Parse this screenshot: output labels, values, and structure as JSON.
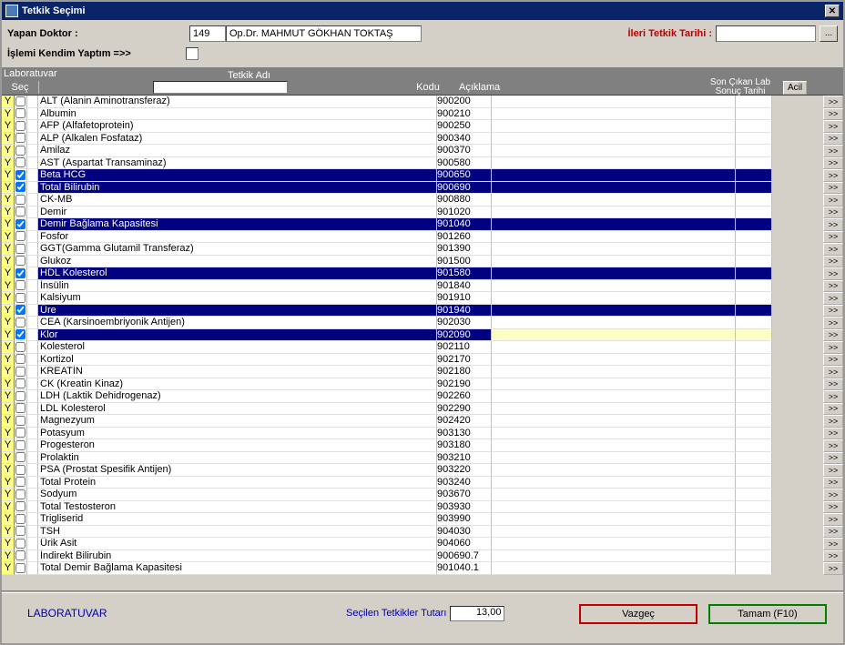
{
  "window": {
    "title": "Tetkik Seçimi"
  },
  "header": {
    "doctor_label": "Yapan Doktor :",
    "doctor_id": "149",
    "doctor_name": "Op.Dr. MAHMUT GÖKHAN TOKTAŞ",
    "ileri_tarih_label": "İleri Tetkik Tarihi :",
    "ileri_tarih_value": "",
    "self_label": "İşlemi Kendim Yaptım =>>"
  },
  "grid": {
    "top_label": "Laboratuvar",
    "col_sec": "Seç",
    "col_name": "Tetkik Adı",
    "col_kodu": "Kodu",
    "col_aciklama": "Açıklama",
    "col_sontarih": "Son Çıkan Lab Sonuç Tarihi",
    "col_acil": "Acil",
    "detail_btn": ">>",
    "search_value": ""
  },
  "rows": [
    {
      "y": "Y",
      "sel": false,
      "name": "ALT (Alanin Aminotransferaz)",
      "kodu": "900200",
      "active": false
    },
    {
      "y": "Y",
      "sel": false,
      "name": "Albumin",
      "kodu": "900210",
      "active": false
    },
    {
      "y": "Y",
      "sel": false,
      "name": "AFP (Alfafetoprotein)",
      "kodu": "900250",
      "active": false
    },
    {
      "y": "Y",
      "sel": false,
      "name": "ALP (Alkalen Fosfataz)",
      "kodu": "900340",
      "active": false
    },
    {
      "y": "Y",
      "sel": false,
      "name": "Amilaz",
      "kodu": "900370",
      "active": false
    },
    {
      "y": "Y",
      "sel": false,
      "name": "AST (Aspartat Transaminaz)",
      "kodu": "900580",
      "active": false
    },
    {
      "y": "Y",
      "sel": true,
      "name": "Beta HCG",
      "kodu": "900650",
      "active": false
    },
    {
      "y": "Y",
      "sel": true,
      "name": "Total Bilirubin",
      "kodu": "900690",
      "active": false
    },
    {
      "y": "Y",
      "sel": false,
      "name": "CK-MB",
      "kodu": "900880",
      "active": false
    },
    {
      "y": "Y",
      "sel": false,
      "name": "Demir",
      "kodu": "901020",
      "active": false
    },
    {
      "y": "Y",
      "sel": true,
      "name": "Demir Bağlama Kapasitesi",
      "kodu": "901040",
      "active": false
    },
    {
      "y": "Y",
      "sel": false,
      "name": "Fosfor",
      "kodu": "901260",
      "active": false
    },
    {
      "y": "Y",
      "sel": false,
      "name": "GGT(Gamma Glutamil Transferaz)",
      "kodu": "901390",
      "active": false
    },
    {
      "y": "Y",
      "sel": false,
      "name": "Glukoz",
      "kodu": "901500",
      "active": false
    },
    {
      "y": "Y",
      "sel": true,
      "name": "HDL Kolesterol",
      "kodu": "901580",
      "active": false
    },
    {
      "y": "Y",
      "sel": false,
      "name": "İnsülin",
      "kodu": "901840",
      "active": false
    },
    {
      "y": "Y",
      "sel": false,
      "name": "Kalsiyum",
      "kodu": "901910",
      "active": false
    },
    {
      "y": "Y",
      "sel": true,
      "name": "Üre",
      "kodu": "901940",
      "active": false
    },
    {
      "y": "Y",
      "sel": false,
      "name": "CEA (Karsinoembriyonik Antijen)",
      "kodu": "902030",
      "active": false
    },
    {
      "y": "Y",
      "sel": true,
      "name": "Klor",
      "kodu": "902090",
      "active": true
    },
    {
      "y": "Y",
      "sel": false,
      "name": "Kolesterol",
      "kodu": "902110",
      "active": false
    },
    {
      "y": "Y",
      "sel": false,
      "name": "Kortizol",
      "kodu": "902170",
      "active": false
    },
    {
      "y": "Y",
      "sel": false,
      "name": "KREATİN",
      "kodu": "902180",
      "active": false
    },
    {
      "y": "Y",
      "sel": false,
      "name": "CK (Kreatin Kinaz)",
      "kodu": "902190",
      "active": false
    },
    {
      "y": "Y",
      "sel": false,
      "name": "LDH (Laktik Dehidrogenaz)",
      "kodu": "902260",
      "active": false
    },
    {
      "y": "Y",
      "sel": false,
      "name": "LDL Kolesterol",
      "kodu": "902290",
      "active": false
    },
    {
      "y": "Y",
      "sel": false,
      "name": "Magnezyum",
      "kodu": "902420",
      "active": false
    },
    {
      "y": "Y",
      "sel": false,
      "name": "Potasyum",
      "kodu": "903130",
      "active": false
    },
    {
      "y": "Y",
      "sel": false,
      "name": "Progesteron",
      "kodu": "903180",
      "active": false
    },
    {
      "y": "Y",
      "sel": false,
      "name": "Prolaktin",
      "kodu": "903210",
      "active": false
    },
    {
      "y": "Y",
      "sel": false,
      "name": "PSA (Prostat Spesifik Antijen)",
      "kodu": "903220",
      "active": false
    },
    {
      "y": "Y",
      "sel": false,
      "name": "Total Protein",
      "kodu": "903240",
      "active": false
    },
    {
      "y": "Y",
      "sel": false,
      "name": "Sodyum",
      "kodu": "903670",
      "active": false
    },
    {
      "y": "Y",
      "sel": false,
      "name": "Total Testosteron",
      "kodu": "903930",
      "active": false
    },
    {
      "y": "Y",
      "sel": false,
      "name": "Trigliserid",
      "kodu": "903990",
      "active": false
    },
    {
      "y": "Y",
      "sel": false,
      "name": "TSH",
      "kodu": "904030",
      "active": false
    },
    {
      "y": "Y",
      "sel": false,
      "name": "Ürik Asit",
      "kodu": "904060",
      "active": false
    },
    {
      "y": "Y",
      "sel": false,
      "name": "İndirekt Bilirubin",
      "kodu": "900690.7",
      "active": false
    },
    {
      "y": "Y",
      "sel": false,
      "name": "Total Demir Bağlama Kapasitesi",
      "kodu": "901040.1",
      "active": false
    }
  ],
  "footer": {
    "lab_label": "LABORATUVAR",
    "total_label": "Seçilen Tetkikler Tutarı",
    "total_value": "13,00",
    "cancel": "Vazgeç",
    "ok": "Tamam (F10)"
  }
}
